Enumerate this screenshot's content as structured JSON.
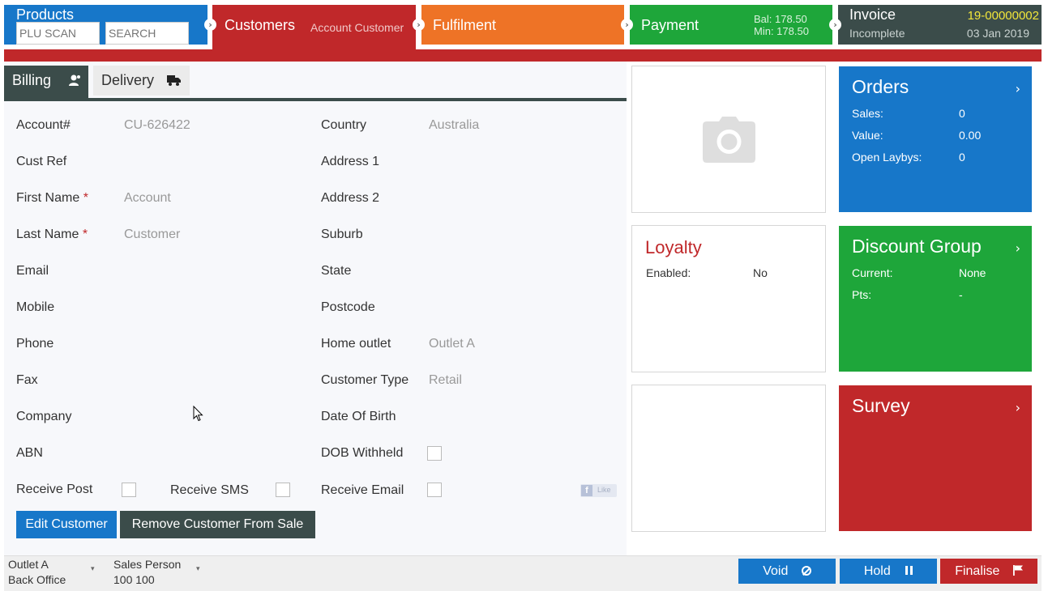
{
  "nav": {
    "products": {
      "title": "Products",
      "plu_placeholder": "PLU SCAN",
      "search_placeholder": "SEARCH"
    },
    "customers": {
      "title": "Customers",
      "subtitle": "Account Customer"
    },
    "fulfilment": {
      "title": "Fulfilment"
    },
    "payment": {
      "title": "Payment",
      "bal": "Bal: 178.50",
      "min": "Min: 178.50"
    },
    "invoice": {
      "title": "Invoice",
      "status": "Incomplete",
      "number": "19-00000002",
      "date": "03 Jan 2019"
    }
  },
  "tabs": {
    "billing": "Billing",
    "delivery": "Delivery"
  },
  "form": {
    "left": [
      {
        "label": "Account#",
        "value": "CU-626422",
        "required": ""
      },
      {
        "label": "Cust Ref",
        "value": "",
        "required": ""
      },
      {
        "label": "First Name",
        "value": "Account",
        "required": "*"
      },
      {
        "label": "Last Name",
        "value": "Customer",
        "required": "*"
      },
      {
        "label": "Email",
        "value": "",
        "required": ""
      },
      {
        "label": "Mobile",
        "value": "",
        "required": ""
      },
      {
        "label": "Phone",
        "value": "",
        "required": ""
      },
      {
        "label": "Fax",
        "value": "",
        "required": ""
      },
      {
        "label": "Company",
        "value": "",
        "required": ""
      },
      {
        "label": "ABN",
        "value": "",
        "required": ""
      }
    ],
    "right": [
      {
        "label": "Country",
        "value": "Australia"
      },
      {
        "label": "Address 1",
        "value": ""
      },
      {
        "label": "Address 2",
        "value": ""
      },
      {
        "label": "Suburb",
        "value": ""
      },
      {
        "label": "State",
        "value": ""
      },
      {
        "label": "Postcode",
        "value": ""
      },
      {
        "label": "Home outlet",
        "value": "Outlet A"
      },
      {
        "label": "Customer Type",
        "value": "Retail"
      },
      {
        "label": "Date Of Birth",
        "value": ""
      },
      {
        "label": "DOB Withheld",
        "value": ""
      }
    ],
    "receive_post": "Receive Post",
    "receive_sms": "Receive SMS",
    "receive_email": "Receive Email",
    "fb_like": "Like"
  },
  "buttons": {
    "edit": "Edit Customer",
    "remove": "Remove Customer From Sale"
  },
  "loyalty": {
    "title": "Loyalty",
    "enabled_label": "Enabled:",
    "enabled_value": "No"
  },
  "orders": {
    "title": "Orders",
    "rows": [
      {
        "k": "Sales:",
        "v": "0"
      },
      {
        "k": "Value:",
        "v": "0.00"
      },
      {
        "k": "Open Laybys:",
        "v": "0"
      }
    ]
  },
  "discount": {
    "title": "Discount Group",
    "rows": [
      {
        "k": "Current:",
        "v": "None"
      },
      {
        "k": "Pts:",
        "v": "-"
      }
    ]
  },
  "survey": {
    "title": "Survey"
  },
  "bottom": {
    "outlet": "Outlet A",
    "location": "Back Office",
    "sales_person_label": "Sales Person",
    "sales_person": "100 100",
    "void": "Void",
    "hold": "Hold",
    "finalise": "Finalise"
  },
  "colors": {
    "blue": "#1777c9",
    "red": "#c0282a",
    "orange": "#ee7326",
    "green": "#1ea63a",
    "dark": "#3b4c4a"
  }
}
